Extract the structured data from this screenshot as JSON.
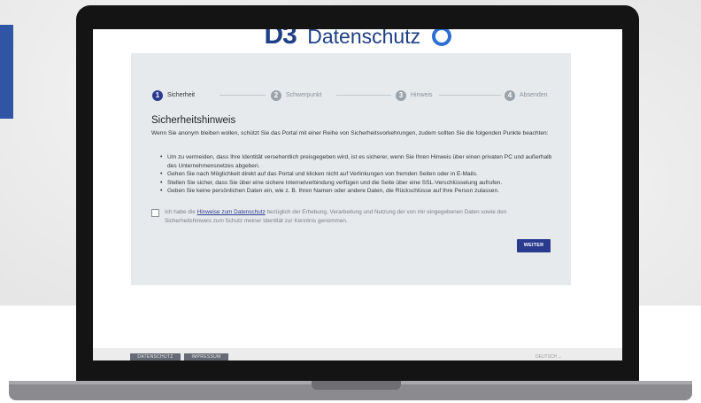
{
  "logo": {
    "mark": "D3",
    "text": "Datenschutz"
  },
  "stepper": [
    {
      "number": "1",
      "label": "Sicherheit",
      "active": true
    },
    {
      "number": "2",
      "label": "Schwerpunkt",
      "active": false
    },
    {
      "number": "3",
      "label": "Hinweis",
      "active": false
    },
    {
      "number": "4",
      "label": "Absenden",
      "active": false
    }
  ],
  "main": {
    "heading": "Sicherheitshinweis",
    "intro": "Wenn Sie anonym bleiben wollen, schützt Sie das Portal mit einer Reihe von Sicherheitsvorkehrungen, zudem sollten Sie die folgenden Punkte beachten:",
    "bullets": [
      "Um zu vermeiden, dass Ihre Identität versehentlich preisgegeben wird, ist es sicherer, wenn Sie Ihren Hinweis über einen privaten PC und außerhalb des Unternehmensnetzes abgeben.",
      "Gehen Sie nach Möglichkeit direkt auf das Portal und klicken nicht auf Verlinkungen von fremden Seiten oder in E-Mails.",
      "Stellen Sie sicher, dass Sie über eine sichere Internetverbindung verfügen und die Seite über eine SSL-Verschlüsselung aufrufen.",
      "Geben Sie keine persönlichen Daten ein, wie z. B. Ihren Namen oder andere Daten, die Rückschlüsse auf Ihre Person zulassen."
    ],
    "consent": {
      "prefix": "Ich habe die ",
      "link": "Hinweise zum Datenschutz",
      "suffix": " bezüglich der Erhebung, Verarbeitung und Nutzung der von mir eingegebenen Daten sowie den Sicherheitshinweis zum Schutz meiner Identität zur Kenntnis genommen."
    },
    "next_button": "WEITER"
  },
  "footer": {
    "datenschutz": "DATENSCHUTZ",
    "impressum": "IMPRESSUM",
    "language": "DEUTSCH ⌄"
  },
  "colors": {
    "brand": "#2a3b8f",
    "card": "#e7eaed",
    "accent_block": "#2f55a4"
  }
}
